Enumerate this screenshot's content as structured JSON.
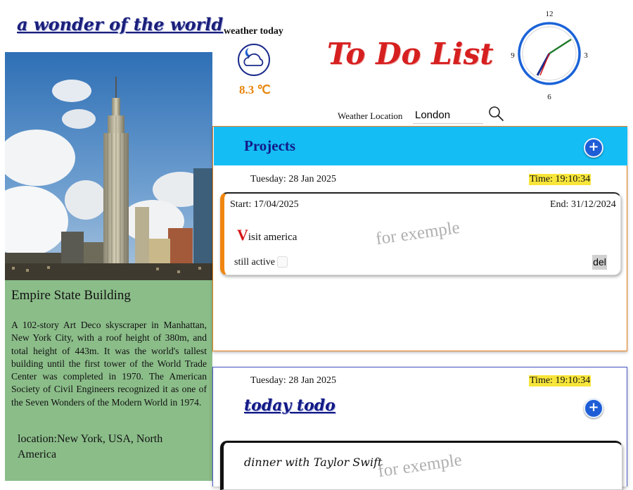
{
  "site": {
    "title": "a wonder of the world"
  },
  "weather": {
    "label": "weather today",
    "temperature": "8.3 ℃",
    "icon": "moon-cloud-icon"
  },
  "app": {
    "title": "To Do List"
  },
  "clock": {
    "numbers": [
      "12",
      "3",
      "6",
      "9"
    ],
    "time": "19:10:34"
  },
  "location": {
    "label": "Weather Location",
    "value": "London",
    "search_icon": "search-icon"
  },
  "wonder": {
    "name": "Empire State Building",
    "description": "A 102-story Art Deco skyscraper in Manhattan, New York City, with a roof height of 380m, and total height of 443m. It was the world's tallest building until the first tower of the World Trade Center was completed in 1970. The American Society of Civil Engineers recognized it as one of the Seven Wonders of the Modern World in 1974.",
    "location": "location:New York, USA, North America"
  },
  "projects": {
    "title": "Projects",
    "add_label": "+",
    "date": "Tuesday: 28 Jan 2025",
    "time": "Time: 19:10:34",
    "card": {
      "start": "Start: 17/04/2025",
      "end": "End: 31/12/2024",
      "task_first": "V",
      "task_rest": "isit america",
      "watermark": "for exemple",
      "active_label": "still active",
      "delete_label": "del"
    }
  },
  "today": {
    "title": "today todo",
    "add_label": "+",
    "date": "Tuesday: 28 Jan 2025",
    "time": "Time: 19:10:34",
    "card": {
      "text": "dinner with Taylor Swift",
      "watermark": "for exemple"
    }
  },
  "colors": {
    "projects_header": "#15bdf5",
    "accent_orange": "#f0860f",
    "title_red": "#d62020",
    "navy": "#121a86",
    "info_panel": "#8bbd89",
    "time_highlight": "#f7e53a"
  }
}
